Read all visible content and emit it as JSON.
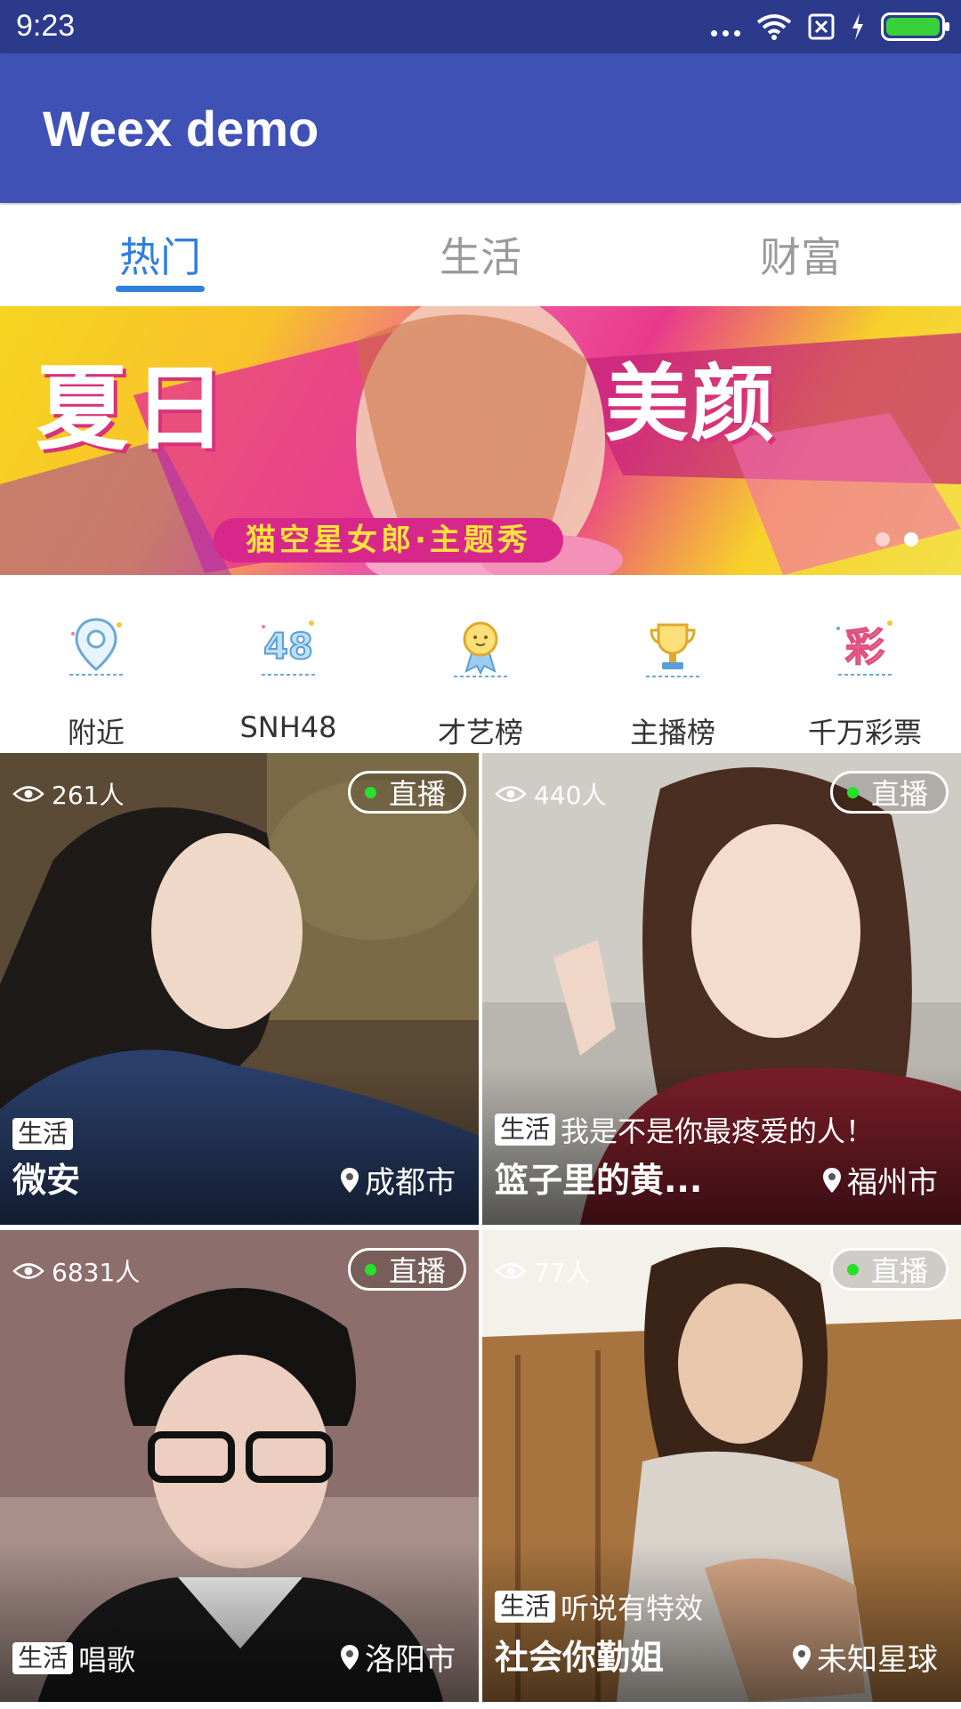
{
  "status_bar": {
    "time": "9:23"
  },
  "app_bar": {
    "title": "Weex demo"
  },
  "tabs": [
    {
      "label": "热门",
      "active": true
    },
    {
      "label": "生活",
      "active": false
    },
    {
      "label": "财富",
      "active": false
    }
  ],
  "banner": {
    "title_left": "夏日",
    "title_right": "美颜",
    "subtitle": "猫空星女郎·主题秀",
    "page_count": 2,
    "current_page": 2
  },
  "categories": [
    {
      "label": "附近",
      "icon": "location-pin-icon"
    },
    {
      "label": "SNH48",
      "icon": "snh48-icon"
    },
    {
      "label": "才艺榜",
      "icon": "medal-icon"
    },
    {
      "label": "主播榜",
      "icon": "trophy-icon"
    },
    {
      "label": "千万彩票",
      "icon": "lottery-icon"
    }
  ],
  "cards": [
    {
      "viewers": "261人",
      "live": "直播",
      "tag": "生活",
      "caption": "",
      "name": "微安",
      "location": "成都市"
    },
    {
      "viewers": "440人",
      "live": "直播",
      "tag": "生活",
      "caption": "我是不是你最疼爱的人！",
      "name": "篮子里的黄...",
      "location": "福州市"
    },
    {
      "viewers": "6831人",
      "live": "直播",
      "tag": "生活",
      "caption": "唱歌",
      "name": "",
      "location": "洛阳市"
    },
    {
      "viewers": "77人",
      "live": "直播",
      "tag": "生活",
      "caption": "听说有特效",
      "name": "社会你勤姐",
      "location": "未知星球"
    }
  ],
  "colors": {
    "status_bar": "#2c3a8c",
    "app_bar": "#3f51b5",
    "tab_active": "#2f7fe0",
    "tab_inactive": "#9a9a9a",
    "live_dot": "#26e02a"
  }
}
